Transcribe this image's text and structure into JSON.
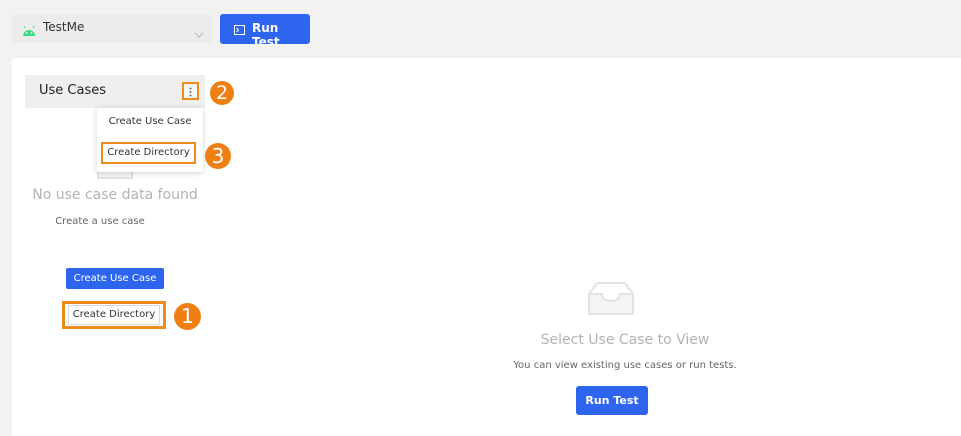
{
  "toolbar": {
    "app_name": "TestMe",
    "run_test_label": "Run Test"
  },
  "use_cases_panel": {
    "title": "Use Cases",
    "menu_items": [
      "Create Use Case",
      "Create Directory"
    ],
    "empty_title": "No use case data found",
    "empty_subtitle": "Create a use case",
    "create_use_case_label": "Create Use Case",
    "create_directory_label": "Create Directory"
  },
  "detail_panel": {
    "empty_title": "Select Use Case to View",
    "empty_subtitle": "You can view existing use cases or run tests.",
    "run_test_label": "Run Test"
  },
  "annotations": {
    "badge_1": "1",
    "badge_2": "2",
    "badge_3": "3"
  },
  "colors": {
    "primary": "#2e65ee",
    "highlight": "#f08a1e",
    "android_green": "#3ddc84"
  },
  "icons": [
    "android-icon",
    "chevron-down-icon",
    "terminal-icon",
    "more-vertical-icon",
    "empty-inbox-icon"
  ]
}
